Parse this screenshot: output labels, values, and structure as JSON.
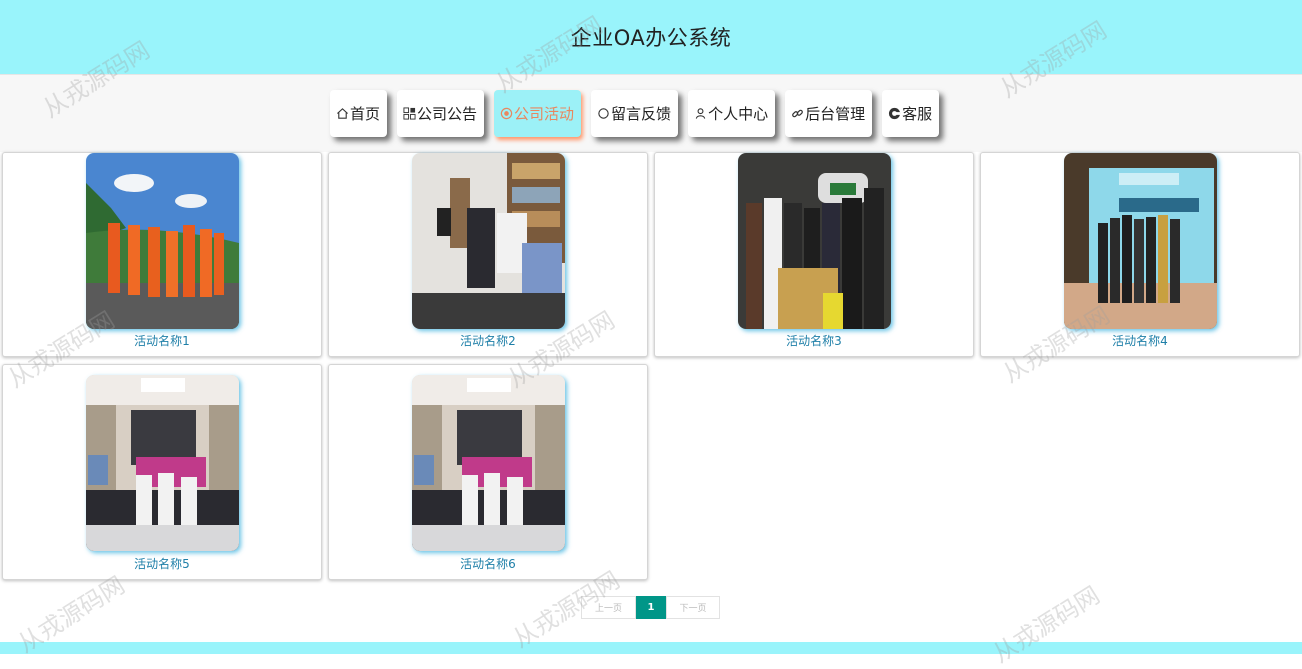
{
  "header": {
    "title": "企业OA办公系统"
  },
  "nav": {
    "items": [
      {
        "label": "首页",
        "icon": "home-icon"
      },
      {
        "label": "公司公告",
        "icon": "apps-icon"
      },
      {
        "label": "公司活动",
        "icon": "target-icon",
        "active": true
      },
      {
        "label": "留言反馈",
        "icon": "circle-icon"
      },
      {
        "label": "个人中心",
        "icon": "user-icon"
      },
      {
        "label": "后台管理",
        "icon": "link-icon"
      },
      {
        "label": "客服",
        "icon": "service-icon"
      }
    ]
  },
  "activities": [
    {
      "name": "活动名称1",
      "scene": "outdoor-group"
    },
    {
      "name": "活动名称2",
      "scene": "indoor-meeting"
    },
    {
      "name": "活动名称3",
      "scene": "group-photo"
    },
    {
      "name": "活动名称4",
      "scene": "stage-banner"
    },
    {
      "name": "活动名称5",
      "scene": "conference-hall"
    },
    {
      "name": "活动名称6",
      "scene": "conference-hall"
    }
  ],
  "pagination": {
    "prev": "上一页",
    "current": "1",
    "next": "下一页"
  },
  "watermark": "从戎源码网",
  "colors": {
    "header": "#99f4fb",
    "accent": "#e8875f",
    "link": "#1e7fa8",
    "pager_active": "#009688"
  }
}
